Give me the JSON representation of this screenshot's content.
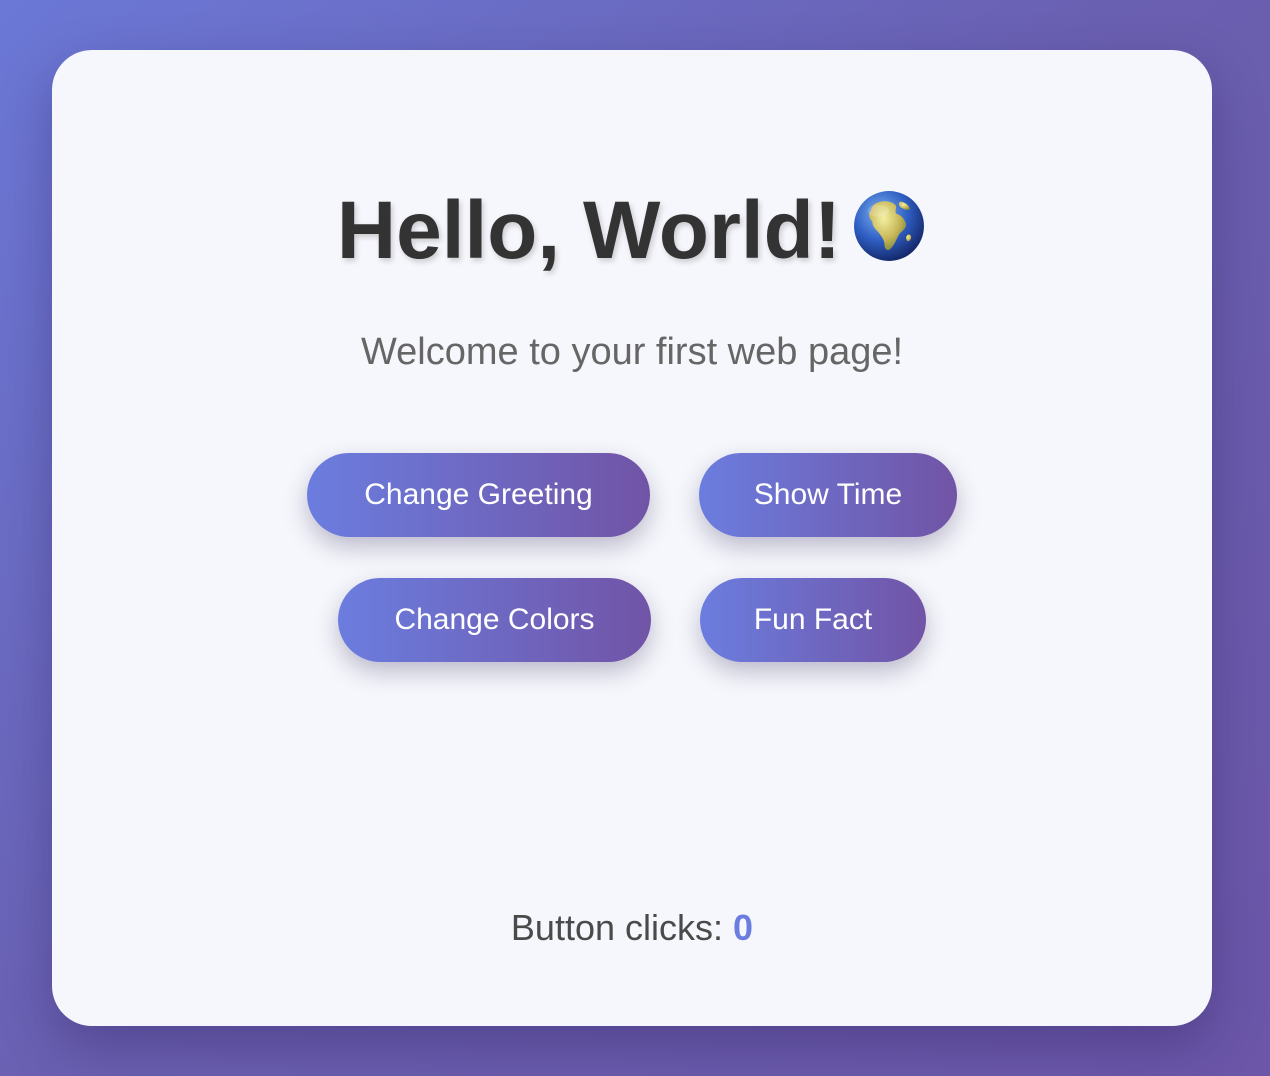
{
  "title": "Hello, World!",
  "subtitle": "Welcome to your first web page!",
  "buttons": {
    "change_greeting": "Change Greeting",
    "show_time": "Show Time",
    "change_colors": "Change Colors",
    "fun_fact": "Fun Fact"
  },
  "counter": {
    "label": "Button clicks:",
    "value": "0"
  },
  "icons": {
    "title_icon": "globe-africa-icon"
  },
  "colors": {
    "accent": "#6b7ddf",
    "button_gradient_start": "#6b7ddf",
    "button_gradient_end": "#7154a6",
    "title": "#333333",
    "card_background": "#f6f7fc"
  }
}
